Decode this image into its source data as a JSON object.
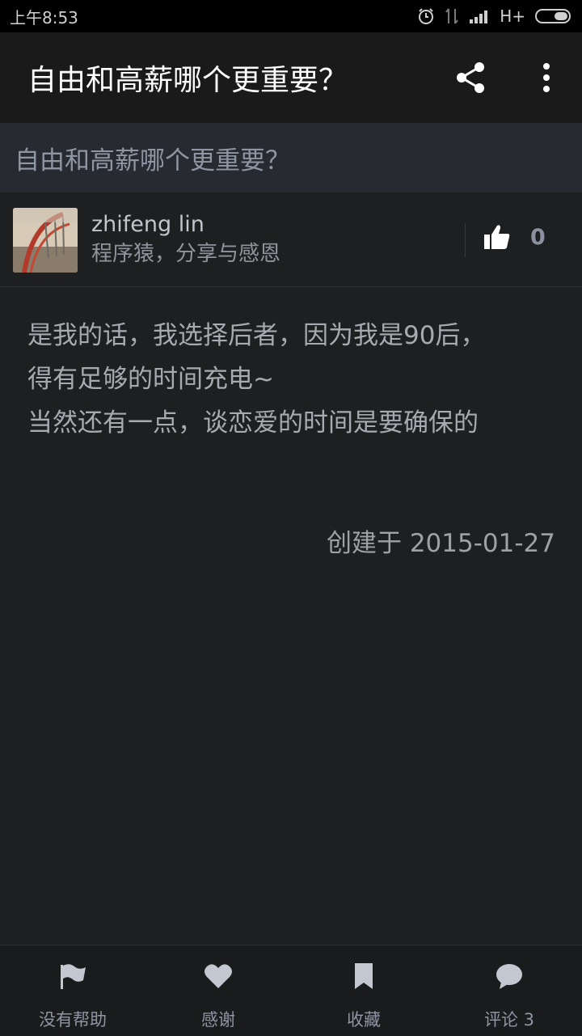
{
  "status_bar": {
    "time": "上午8:53",
    "network": "H+"
  },
  "app_bar": {
    "title": "自由和高薪哪个更重要？",
    "share_icon": "share-icon",
    "more_icon": "more-vert-icon"
  },
  "question": {
    "title": "自由和高薪哪个更重要？"
  },
  "author": {
    "name": "zhifeng lin",
    "bio": "程序猿，分享与感恩",
    "vote_count": "0"
  },
  "answer": {
    "lines": [
      "是我的话，我选择后者，因为我是90后，",
      "得有足够的时间充电~",
      "当然还有一点，谈恋爱的时间是要确保的"
    ],
    "created": "创建于 2015-01-27"
  },
  "bottom_bar": {
    "tabs": [
      {
        "label": "没有帮助",
        "icon": "flag-icon"
      },
      {
        "label": "感谢",
        "icon": "heart-icon"
      },
      {
        "label": "收藏",
        "icon": "bookmark-icon"
      },
      {
        "label": "评论 3",
        "icon": "comment-icon"
      }
    ]
  },
  "colors": {
    "background": "#1e1f21",
    "app_bar": "#1a1a1b",
    "question_bar": "#272b31",
    "accent_text": "#8e96a3"
  }
}
